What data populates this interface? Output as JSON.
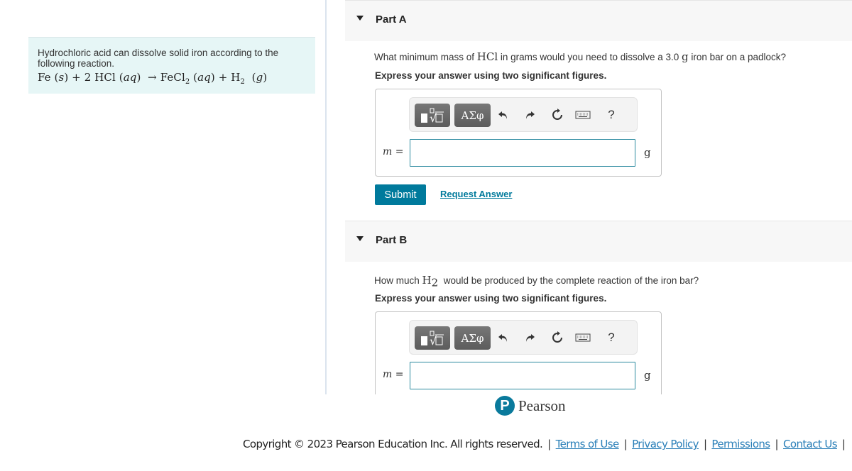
{
  "intro": {
    "text": "Hydrochloric acid can dissolve solid iron according to the following reaction.",
    "equation": {
      "reactant1": "Fe",
      "state1": "s",
      "coef2": "2",
      "reactant2": "HCl",
      "state2": "aq",
      "product1": "FeCl",
      "product1_sub": "2",
      "state3": "aq",
      "product2": "H",
      "product2_sub": "2",
      "state4": "g",
      "arrow": "→",
      "plus": "+"
    }
  },
  "parts": [
    {
      "title": "Part A",
      "question_pre": "What minimum mass of ",
      "question_math": "HCl",
      "question_mid": " in grams would you need to dissolve a 3.0 ",
      "question_unit": "g",
      "question_post": " iron bar on a padlock?",
      "instruction": "Express your answer using two significant figures.",
      "variable": "m",
      "equals": "=",
      "input_value": "",
      "unit": "g",
      "submit_label": "Submit",
      "request_label": "Request Answer"
    },
    {
      "title": "Part B",
      "question_pre": "How much ",
      "question_math": "H",
      "question_math_sub": "2",
      "question_post": " would be produced by the complete reaction of the iron bar?",
      "instruction": "Express your answer using two significant figures.",
      "variable": "m",
      "equals": "=",
      "input_value": "",
      "unit": "g"
    }
  ],
  "toolbar": {
    "greek_label": "ΑΣφ",
    "help_label": "?",
    "icons": [
      "templates-icon",
      "greek-symbols-icon",
      "undo-icon",
      "redo-icon",
      "reset-icon",
      "keyboard-icon",
      "help-icon"
    ]
  },
  "brand": {
    "name": "Pearson",
    "mark": "P",
    "color": "#0a7a9c"
  },
  "footer": {
    "copyright": "Copyright © 2023 Pearson Education Inc. All rights reserved.",
    "separator": "|",
    "links": [
      "Terms of Use",
      "Privacy Policy",
      "Permissions",
      "Contact Us"
    ]
  },
  "colors": {
    "accent": "#007a9c",
    "intro_bg": "#e6f6f6",
    "link": "#2a7fb8"
  }
}
